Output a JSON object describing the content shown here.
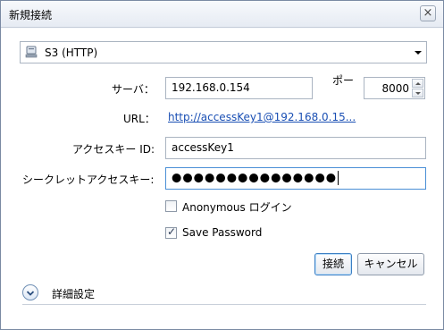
{
  "window": {
    "title": "新規接続",
    "close_glyph": "×"
  },
  "protocol": {
    "selected": "S3 (HTTP)",
    "icon": "server-icon"
  },
  "server": {
    "label": "サーバ：",
    "value": "192.168.0.154"
  },
  "port": {
    "label": "ポー",
    "value": "8000"
  },
  "url": {
    "label": "URL：",
    "value": "http://accessKey1@192.168.0.15..."
  },
  "access_key": {
    "label": "アクセスキー ID:",
    "value": "accessKey1"
  },
  "secret_key": {
    "label": "シークレットアクセスキー:",
    "value": "●●●●●●●●●●●●●●●"
  },
  "anonymous": {
    "label": "Anonymous ログイン",
    "checked": false
  },
  "save_password": {
    "label": "Save Password",
    "checked": true,
    "check_glyph": "✓"
  },
  "buttons": {
    "connect": "接続",
    "cancel": "キャンセル"
  },
  "details": {
    "label": "詳細設定",
    "icon": "chevron-down-icon"
  },
  "colors": {
    "link": "#1a4fb4",
    "focus": "#4a8fd6"
  }
}
